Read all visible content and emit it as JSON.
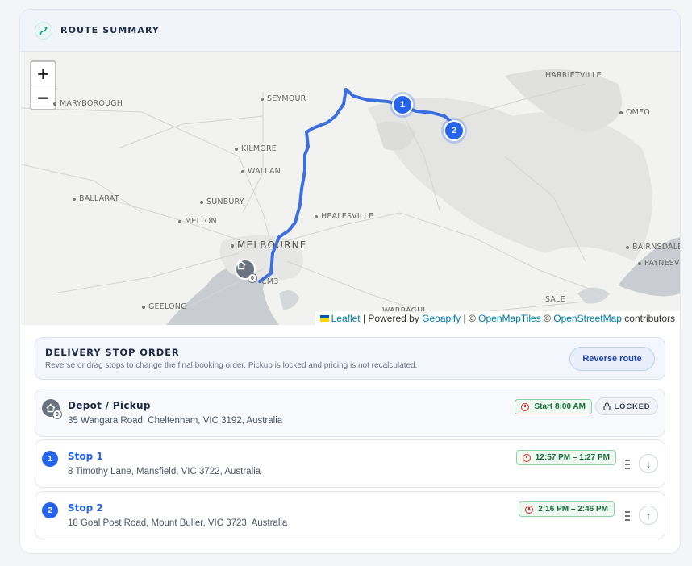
{
  "header": {
    "title": "ROUTE SUMMARY",
    "icon": "route-icon"
  },
  "map": {
    "zoom_in": "+",
    "zoom_out": "−",
    "places": {
      "harrietville": "HARRIETVILLE",
      "maryborough": "MARYBOROUGH",
      "seymour": "SEYMOUR",
      "omeo": "OMEO",
      "kilmore": "KILMORE",
      "wallan": "WALLAN",
      "ballarat": "BALLARAT",
      "sunbury": "SUNBURY",
      "healesville": "HEALESVILLE",
      "melton": "MELTON",
      "melbourne": "MELBOURNE",
      "bairnsdale": "BAIRNSDALE",
      "paynesville": "PAYNESV",
      "cm3": "CM3",
      "sale": "SALE",
      "geelong": "GEELONG",
      "warragul": "WARRAGUL"
    },
    "markers": {
      "stop1": "1",
      "stop2": "2",
      "depot": "0"
    },
    "attribution": {
      "leaflet": "Leaflet",
      "powered": " | Powered by ",
      "geoapify": "Geoapify",
      "sep": " | © ",
      "openmaptiles": "OpenMapTiles",
      "copy": " © ",
      "osm": "OpenStreetMap",
      "contributors": " contributors"
    },
    "route_color": "#3b6fe0"
  },
  "order": {
    "title": "DELIVERY STOP ORDER",
    "subtitle": "Reverse or drag stops to change the final booking order. Pickup is locked and pricing is not recalculated.",
    "reverse_label": "Reverse route"
  },
  "stops": [
    {
      "name": "Depot / Pickup",
      "address": "35 Wangara Road, Cheltenham, VIC 3192, Australia",
      "time": "Start 8:00 AM",
      "badge": "0",
      "status": "LOCKED"
    },
    {
      "number": "1",
      "name": "Stop 1",
      "address": "8 Timothy Lane, Mansfield, VIC 3722, Australia",
      "time": "12:57 PM – 1:27 PM",
      "move": "↓"
    },
    {
      "number": "2",
      "name": "Stop 2",
      "address": "18 Goal Post Road, Mount Buller, VIC 3723, Australia",
      "time": "2:16 PM – 2:46 PM",
      "move": "↑"
    }
  ],
  "colors": {
    "accent": "#2563eb",
    "time_green": "#176b3a",
    "clock_red": "#dc2626"
  }
}
